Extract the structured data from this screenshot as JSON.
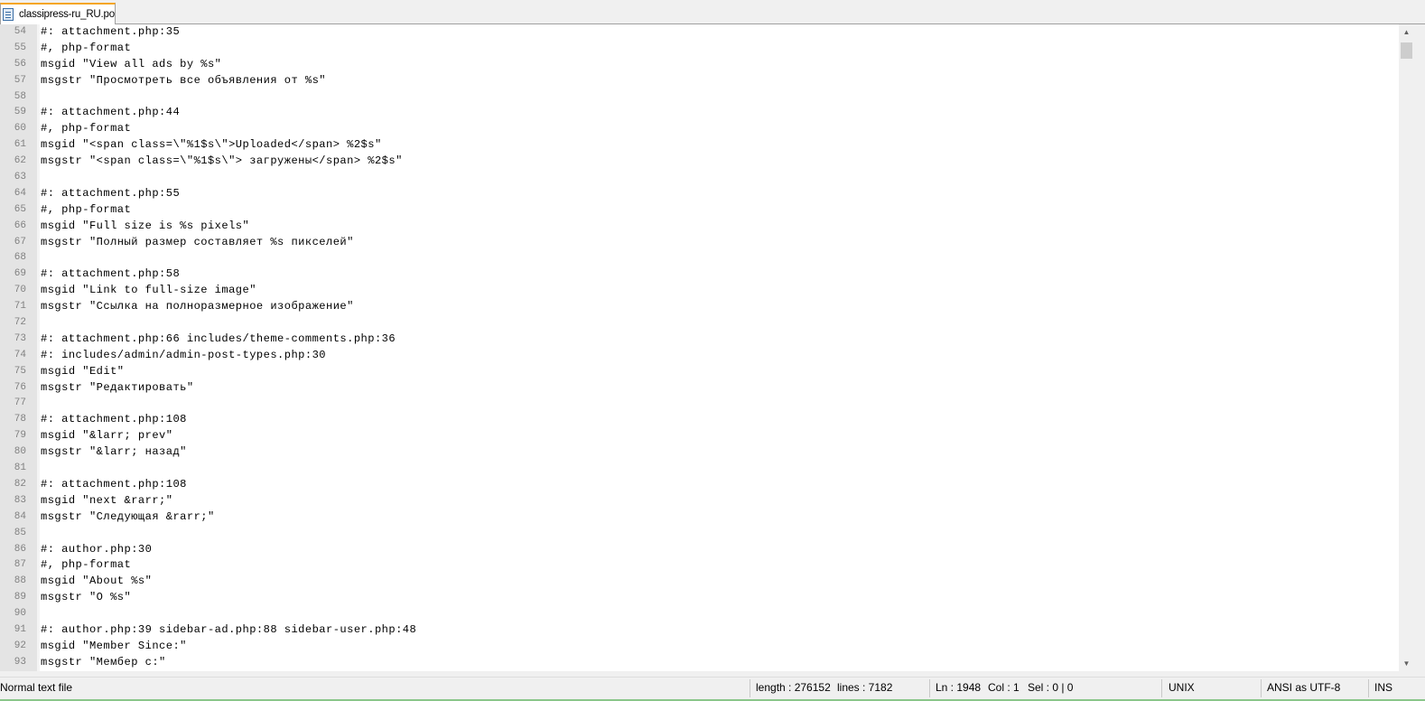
{
  "tab": {
    "label": "classipress-ru_RU.po",
    "icon": "file-icon"
  },
  "editor": {
    "lines": [
      {
        "n": "54",
        "text": "#: attachment.php:35"
      },
      {
        "n": "55",
        "text": "#, php-format"
      },
      {
        "n": "56",
        "text": "msgid \"View all ads by %s\""
      },
      {
        "n": "57",
        "text": "msgstr \"Просмотреть все объявления от %s\""
      },
      {
        "n": "58",
        "text": ""
      },
      {
        "n": "59",
        "text": "#: attachment.php:44"
      },
      {
        "n": "60",
        "text": "#, php-format"
      },
      {
        "n": "61",
        "text": "msgid \"<span class=\\\"%1$s\\\">Uploaded</span> %2$s\""
      },
      {
        "n": "62",
        "text": "msgstr \"<span class=\\\"%1$s\\\"> загружены</span> %2$s\""
      },
      {
        "n": "63",
        "text": ""
      },
      {
        "n": "64",
        "text": "#: attachment.php:55"
      },
      {
        "n": "65",
        "text": "#, php-format"
      },
      {
        "n": "66",
        "text": "msgid \"Full size is %s pixels\""
      },
      {
        "n": "67",
        "text": "msgstr \"Полный размер составляет %s пикселей\""
      },
      {
        "n": "68",
        "text": ""
      },
      {
        "n": "69",
        "text": "#: attachment.php:58"
      },
      {
        "n": "70",
        "text": "msgid \"Link to full-size image\""
      },
      {
        "n": "71",
        "text": "msgstr \"Ссылка на полноразмерное изображение\""
      },
      {
        "n": "72",
        "text": ""
      },
      {
        "n": "73",
        "text": "#: attachment.php:66 includes/theme-comments.php:36"
      },
      {
        "n": "74",
        "text": "#: includes/admin/admin-post-types.php:30"
      },
      {
        "n": "75",
        "text": "msgid \"Edit\""
      },
      {
        "n": "76",
        "text": "msgstr \"Редактировать\""
      },
      {
        "n": "77",
        "text": ""
      },
      {
        "n": "78",
        "text": "#: attachment.php:108"
      },
      {
        "n": "79",
        "text": "msgid \"&larr; prev\""
      },
      {
        "n": "80",
        "text": "msgstr \"&larr; назад\""
      },
      {
        "n": "81",
        "text": ""
      },
      {
        "n": "82",
        "text": "#: attachment.php:108"
      },
      {
        "n": "83",
        "text": "msgid \"next &rarr;\""
      },
      {
        "n": "84",
        "text": "msgstr \"Следующая &rarr;\""
      },
      {
        "n": "85",
        "text": ""
      },
      {
        "n": "86",
        "text": "#: author.php:30"
      },
      {
        "n": "87",
        "text": "#, php-format"
      },
      {
        "n": "88",
        "text": "msgid \"About %s\""
      },
      {
        "n": "89",
        "text": "msgstr \"О %s\""
      },
      {
        "n": "90",
        "text": ""
      },
      {
        "n": "91",
        "text": "#: author.php:39 sidebar-ad.php:88 sidebar-user.php:48"
      },
      {
        "n": "92",
        "text": "msgid \"Member Since:\""
      },
      {
        "n": "93",
        "text": "msgstr \"Мембер с:\""
      }
    ]
  },
  "status": {
    "file_type": "Normal text file",
    "length": "length : 276152",
    "lines": "lines : 7182",
    "ln": "Ln : 1948",
    "col": "Col : 1",
    "sel": "Sel : 0 | 0",
    "eol": "UNIX",
    "encoding": "ANSI as UTF-8",
    "mode": "INS"
  },
  "colors": {
    "tab_accent": "#f5a623",
    "gutter": "#e4e4e4",
    "status_accent": "#8ac68a"
  }
}
